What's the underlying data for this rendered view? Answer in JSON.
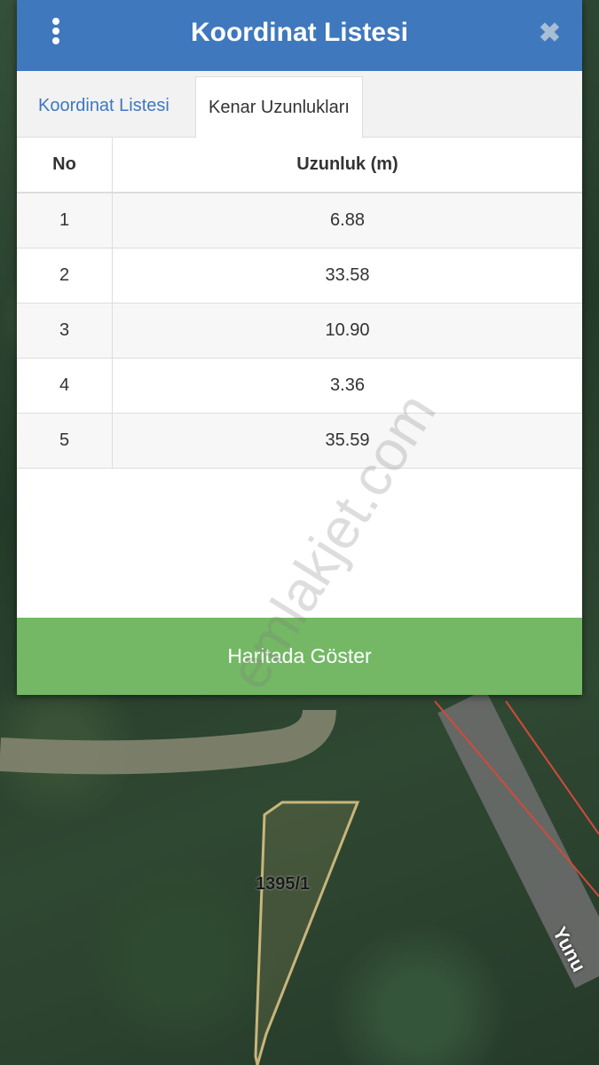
{
  "dialog": {
    "title": "Koordinat Listesi",
    "close_symbol": "✖",
    "tabs": [
      {
        "label": "Koordinat Listesi",
        "active": false
      },
      {
        "label": "Kenar Uzunlukları",
        "active": true
      }
    ],
    "table": {
      "headers": [
        "No",
        "Uzunluk (m)"
      ],
      "rows": [
        [
          "1",
          "6.88"
        ],
        [
          "2",
          "33.58"
        ],
        [
          "3",
          "10.90"
        ],
        [
          "4",
          "3.36"
        ],
        [
          "5",
          "35.59"
        ]
      ]
    },
    "button_label": "Haritada Göster"
  },
  "map": {
    "parcel_label": "1395/1",
    "road_label": "Yunu"
  },
  "watermark": "emlakjet.com",
  "colors": {
    "header": "#3f78bd",
    "button": "#74b866",
    "parcel_outline": "#c8b67a"
  }
}
